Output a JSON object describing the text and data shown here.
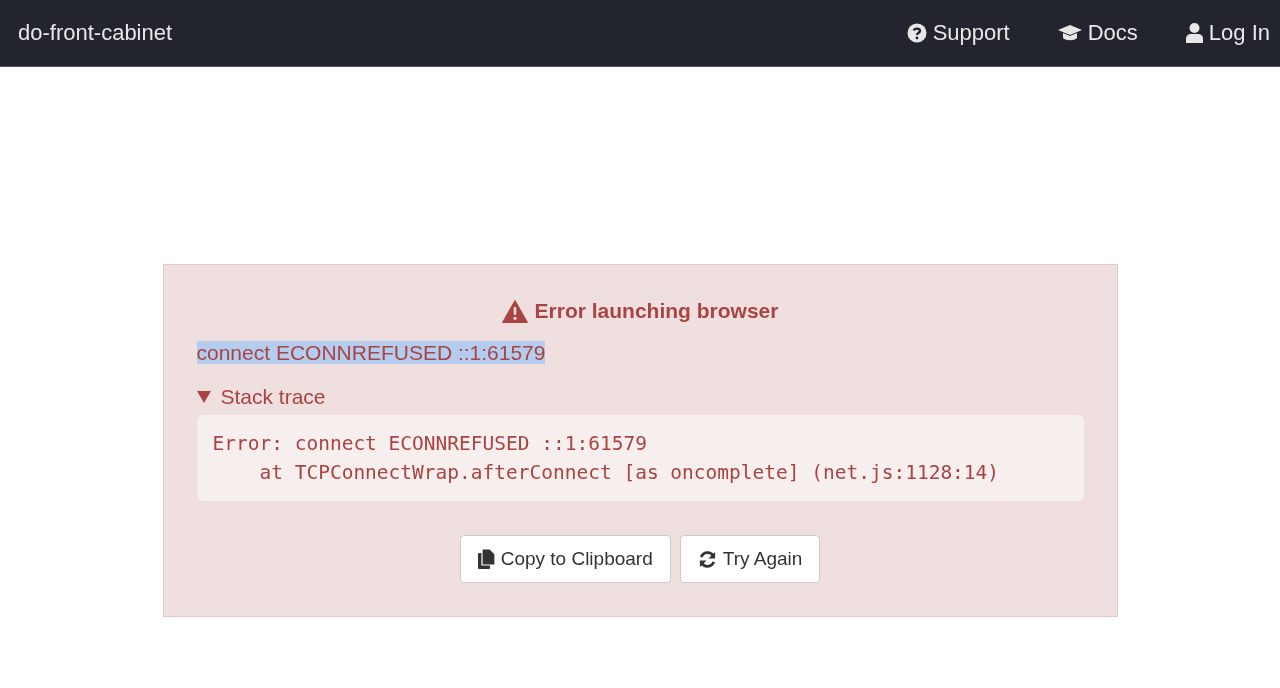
{
  "navbar": {
    "brand": "do-front-cabinet",
    "links": [
      {
        "kind": "support",
        "label": "Support"
      },
      {
        "kind": "docs",
        "label": "Docs"
      },
      {
        "kind": "login",
        "label": "Log In"
      }
    ]
  },
  "error": {
    "title": "Error launching browser",
    "message": {
      "text": "connect ECONNREFUSED ::1:61579",
      "highlighted": true
    },
    "details": {
      "summary": "Stack trace",
      "expanded": true,
      "lines": [
        "Error: connect ECONNREFUSED ::1:61579",
        "    at TCPConnectWrap.afterConnect [as oncomplete] (net.js:1128:14)"
      ]
    },
    "buttons": [
      {
        "kind": "copy",
        "label": "Copy to Clipboard"
      },
      {
        "kind": "retry",
        "label": "Try Again"
      }
    ]
  }
}
